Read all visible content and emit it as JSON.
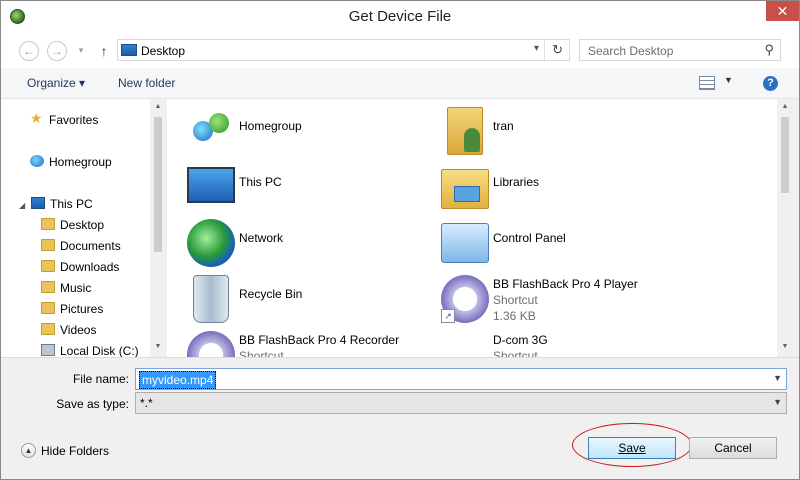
{
  "window": {
    "title": "Get Device File",
    "close_glyph": "✕"
  },
  "address_bar": {
    "location": "Desktop",
    "search_placeholder": "Search Desktop"
  },
  "toolbar": {
    "organize_label": "Organize ▾",
    "new_folder_label": "New folder"
  },
  "sidebar": {
    "items": [
      {
        "label": "Favorites",
        "icon": "star-icon"
      },
      {
        "label": "Homegroup",
        "icon": "homegroup-icon"
      },
      {
        "label": "This PC",
        "icon": "computer-icon"
      },
      {
        "label": "Desktop",
        "icon": "folder-icon"
      },
      {
        "label": "Documents",
        "icon": "folder-icon"
      },
      {
        "label": "Downloads",
        "icon": "folder-icon"
      },
      {
        "label": "Music",
        "icon": "folder-icon"
      },
      {
        "label": "Pictures",
        "icon": "folder-icon"
      },
      {
        "label": "Videos",
        "icon": "folder-icon"
      },
      {
        "label": "Local Disk (C:)",
        "icon": "disk-icon"
      }
    ]
  },
  "files": [
    {
      "name": "Homegroup",
      "icon": "homegroup-icon"
    },
    {
      "name": "tran",
      "icon": "user-folder-icon"
    },
    {
      "name": "This PC",
      "icon": "computer-icon"
    },
    {
      "name": "Libraries",
      "icon": "libraries-icon"
    },
    {
      "name": "Network",
      "icon": "network-icon"
    },
    {
      "name": "Control Panel",
      "icon": "control-panel-icon"
    },
    {
      "name": "Recycle Bin",
      "icon": "recycle-bin-icon"
    },
    {
      "name": "BB FlashBack Pro 4 Player",
      "type": "Shortcut",
      "size": "1.36 KB",
      "icon": "flashback-player-icon"
    },
    {
      "name": "BB FlashBack Pro 4 Recorder",
      "type": "Shortcut",
      "icon": "flashback-recorder-icon"
    },
    {
      "name": "D-com 3G",
      "type": "Shortcut",
      "icon": "dcom-icon"
    }
  ],
  "form": {
    "file_name_label": "File name:",
    "file_name_value": "myvideo.mp4",
    "save_type_label": "Save as type:",
    "save_type_value": "*.*"
  },
  "footer": {
    "hide_folders_label": "Hide Folders",
    "save_label": "Save",
    "cancel_label": "Cancel"
  }
}
